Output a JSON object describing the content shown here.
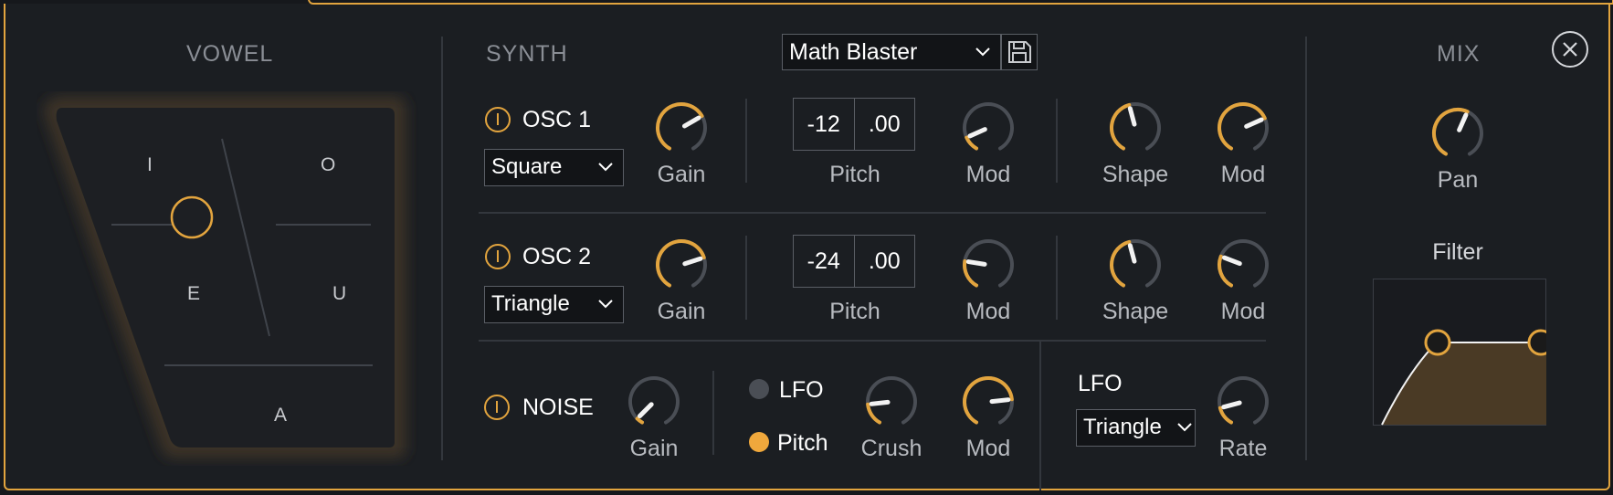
{
  "vowel": {
    "title": "VOWEL",
    "labels": {
      "i": "I",
      "o": "O",
      "e": "E",
      "u": "U",
      "a": "A"
    }
  },
  "synth": {
    "title": "SYNTH",
    "preset": "Math Blaster",
    "osc1": {
      "name": "OSC 1",
      "wave": "Square",
      "gain_label": "Gain",
      "pitch_semis": "-12",
      "pitch_cents": ".00",
      "pitch_label": "Pitch",
      "pitch_mod_label": "Mod",
      "shape_label": "Shape",
      "shape_mod_label": "Mod",
      "gain": 0.7,
      "pitch_mod": 0.12,
      "shape": 0.45,
      "shape_mod": 0.72
    },
    "osc2": {
      "name": "OSC 2",
      "wave": "Triangle",
      "gain_label": "Gain",
      "pitch_semis": "-24",
      "pitch_cents": ".00",
      "pitch_label": "Pitch",
      "pitch_mod_label": "Mod",
      "shape_label": "Shape",
      "shape_mod_label": "Mod",
      "gain": 0.74,
      "pitch_mod": 0.23,
      "shape": 0.45,
      "shape_mod": 0.27
    },
    "noise": {
      "name": "NOISE",
      "gain_label": "Gain",
      "gain": 0.05,
      "lfo_label": "LFO",
      "pitch_label": "Pitch",
      "crush_label": "Crush",
      "crush": 0.18,
      "mod_label": "Mod",
      "mod": 0.78
    },
    "lfo": {
      "title": "LFO",
      "wave": "Triangle",
      "rate_label": "Rate",
      "rate": 0.15
    }
  },
  "mix": {
    "title": "MIX",
    "pan_label": "Pan",
    "pan": 0.58,
    "filter_label": "Filter"
  },
  "colors": {
    "accent": "#e2a43e",
    "panel": "#1b1e22",
    "track": "#4a4e55"
  },
  "icons": {
    "save": "floppy-disk-icon",
    "close": "close-icon",
    "chevron": "chevron-down-icon",
    "power": "power-icon"
  }
}
